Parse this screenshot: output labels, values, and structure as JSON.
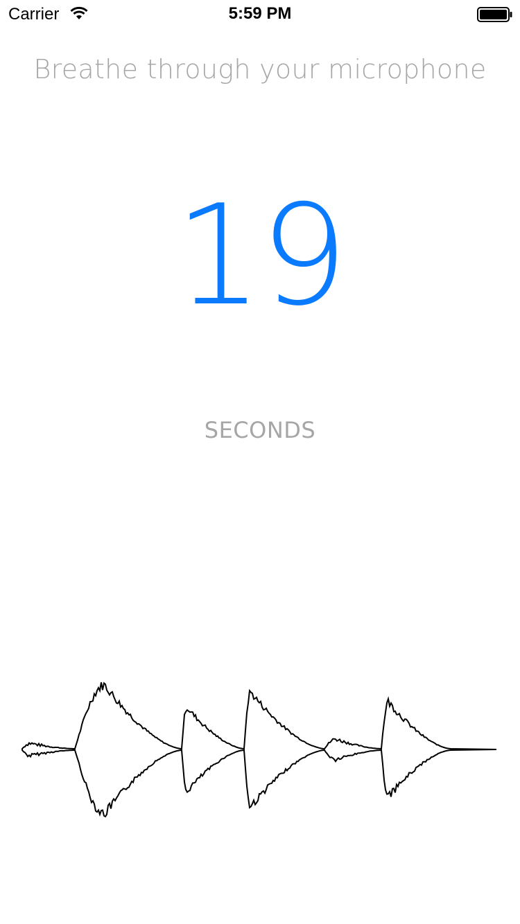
{
  "status_bar": {
    "carrier": "Carrier",
    "time": "5:59 PM",
    "icons": [
      "wifi-icon",
      "battery-icon"
    ]
  },
  "breathing": {
    "prompt": "Breathe through your microphone",
    "count": "19",
    "unit": "SECONDS"
  },
  "colors": {
    "accent": "#0a7aff",
    "muted_text": "#a6a6a6",
    "waveform": "#000000",
    "background": "#ffffff"
  },
  "waveform": {
    "icon": "audio-waveform"
  }
}
